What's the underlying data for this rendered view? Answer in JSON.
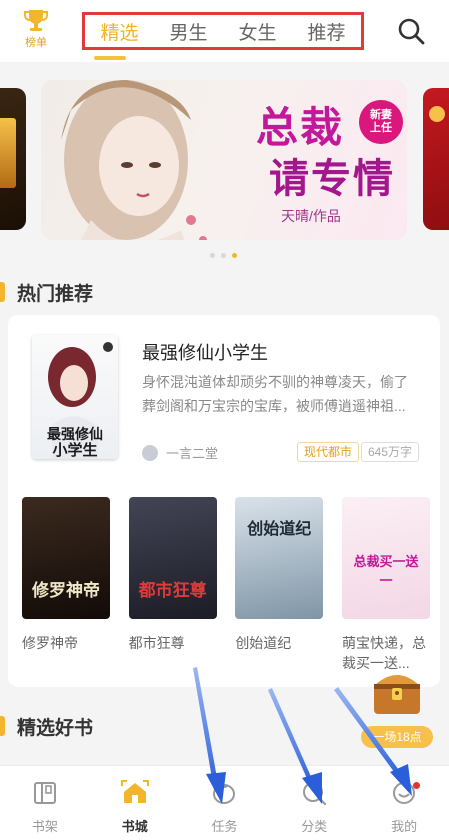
{
  "header": {
    "rank_label": "榜单",
    "tabs": [
      {
        "label": "精选",
        "active": true
      },
      {
        "label": "男生",
        "active": false
      },
      {
        "label": "女生",
        "active": false
      },
      {
        "label": "推荐",
        "active": false
      }
    ]
  },
  "banner": {
    "title_line1": "总裁",
    "title_line2": "请专情",
    "badge_line1": "新妻",
    "badge_line2": "上任",
    "author": "天晴/作品",
    "pages": 3,
    "current_page": 3
  },
  "hot": {
    "section_title": "热门推荐",
    "featured": {
      "title": "最强修仙小学生",
      "description": "身怀混沌道体却顽劣不驯的神尊凌天，偷了葬剑阁和万宝宗的宝库，被师傅逍遥神祖...",
      "author": "一言二堂",
      "genre": "现代都市",
      "words": "645万字",
      "cover_text": "最强修仙小学生"
    },
    "books": [
      {
        "title": "修罗神帝",
        "cover_text": "修罗神帝"
      },
      {
        "title": "都市狂尊",
        "cover_text": "都市狂尊"
      },
      {
        "title": "创始道纪",
        "cover_text": "创始道纪"
      },
      {
        "title": "萌宝快递，总裁买一送...",
        "cover_text": "总裁买一送一"
      }
    ]
  },
  "picks": {
    "section_title": "精选好书"
  },
  "treasure": {
    "timer_label": "一场18点"
  },
  "nav": [
    {
      "label": "书架",
      "icon": "bookshelf-icon",
      "active": false
    },
    {
      "label": "书城",
      "icon": "bookstore-icon",
      "active": true
    },
    {
      "label": "任务",
      "icon": "task-icon",
      "active": false
    },
    {
      "label": "分类",
      "icon": "category-icon",
      "active": false
    },
    {
      "label": "我的",
      "icon": "profile-icon",
      "active": false,
      "has_badge": true
    }
  ],
  "colors": {
    "accent": "#f2b52c",
    "tab_highlight_box": "#e23a3a",
    "annotation_arrow": "#3d6fe0"
  }
}
